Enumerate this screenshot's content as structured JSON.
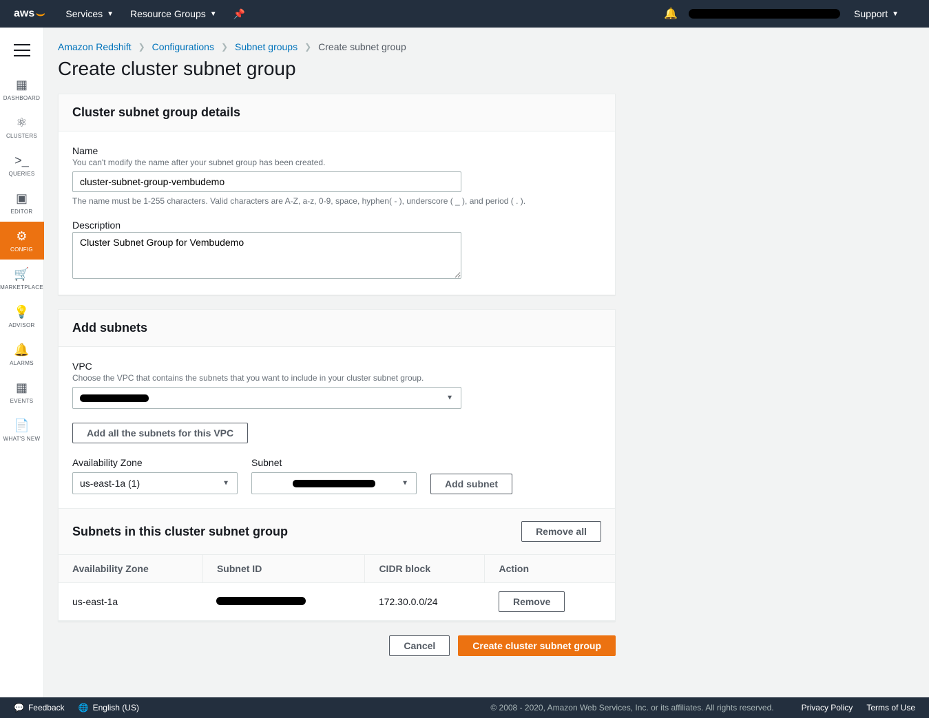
{
  "topnav": {
    "logo": "aws",
    "services": "Services",
    "resource_groups": "Resource Groups",
    "support": "Support"
  },
  "sidenav": {
    "items": [
      {
        "id": "dashboard",
        "label": "DASHBOARD",
        "icon": "grid-icon"
      },
      {
        "id": "clusters",
        "label": "CLUSTERS",
        "icon": "cluster-icon"
      },
      {
        "id": "queries",
        "label": "QUERIES",
        "icon": "terminal-icon"
      },
      {
        "id": "editor",
        "label": "EDITOR",
        "icon": "editor-icon"
      },
      {
        "id": "config",
        "label": "CONFIG",
        "icon": "gear-icon",
        "active": true
      },
      {
        "id": "marketplace",
        "label": "MARKETPLACE",
        "icon": "cart-icon"
      },
      {
        "id": "advisor",
        "label": "ADVISOR",
        "icon": "bulb-icon"
      },
      {
        "id": "alarms",
        "label": "ALARMS",
        "icon": "bell-icon"
      },
      {
        "id": "events",
        "label": "EVENTS",
        "icon": "calendar-icon"
      },
      {
        "id": "whatsnew",
        "label": "WHAT'S NEW",
        "icon": "news-icon"
      }
    ]
  },
  "breadcrumbs": {
    "items": [
      {
        "label": "Amazon Redshift",
        "link": true
      },
      {
        "label": "Configurations",
        "link": true
      },
      {
        "label": "Subnet groups",
        "link": true
      },
      {
        "label": "Create subnet group",
        "link": false
      }
    ]
  },
  "page": {
    "title": "Create cluster subnet group"
  },
  "details": {
    "heading": "Cluster subnet group details",
    "name_label": "Name",
    "name_hint": "You can't modify the name after your subnet group has been created.",
    "name_value": "cluster-subnet-group-vembudemo",
    "name_constraint": "The name must be 1-255 characters. Valid characters are A-Z, a-z, 0-9, space, hyphen( - ), underscore ( _ ), and period ( . ).",
    "desc_label": "Description",
    "desc_value": "Cluster Subnet Group for Vembudemo"
  },
  "add_subnets": {
    "heading": "Add subnets",
    "vpc_label": "VPC",
    "vpc_hint": "Choose the VPC that contains the subnets that you want to include in your cluster subnet group.",
    "vpc_value": "████████",
    "add_all_btn": "Add all the subnets for this VPC",
    "az_label": "Availability Zone",
    "az_value": "us-east-1a (1)",
    "subnet_label": "Subnet",
    "subnet_value": "████████",
    "add_subnet_btn": "Add subnet"
  },
  "subnets_list": {
    "heading": "Subnets in this cluster subnet group",
    "remove_all_btn": "Remove all",
    "columns": {
      "az": "Availability Zone",
      "id": "Subnet ID",
      "cidr": "CIDR block",
      "action": "Action"
    },
    "rows": [
      {
        "az": "us-east-1a",
        "id": "████████",
        "cidr": "172.30.0.0/24",
        "action": "Remove"
      }
    ]
  },
  "actions": {
    "cancel": "Cancel",
    "create": "Create cluster subnet group"
  },
  "footer": {
    "feedback": "Feedback",
    "language": "English (US)",
    "copyright": "© 2008 - 2020, Amazon Web Services, Inc. or its affiliates. All rights reserved.",
    "privacy": "Privacy Policy",
    "terms": "Terms of Use"
  }
}
